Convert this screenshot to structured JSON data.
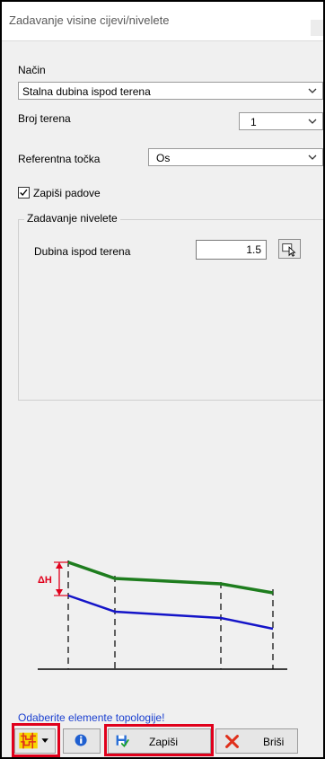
{
  "window": {
    "title": "Zadavanje visine cijevi/nivelete"
  },
  "mode": {
    "label": "Način",
    "value": "Stalna dubina ispod terena"
  },
  "terrain_count": {
    "label": "Broj terena",
    "value": "1"
  },
  "reference_point": {
    "label": "Referentna točka",
    "value": "Os"
  },
  "save_slopes": {
    "label": "Zapiši padove",
    "checked": true
  },
  "grade_group": {
    "title": "Zadavanje nivelete",
    "depth_label": "Dubina ispod terena",
    "depth_value": "1.5"
  },
  "diagram": {
    "delta_label": "ΔH",
    "upper_color": "#1e7d1e",
    "lower_color": "#1414c8"
  },
  "hint": "Odaberite elemente topologije!",
  "toolbar": {
    "save_label": "Zapiši",
    "delete_label": "Briši"
  },
  "colors": {
    "highlight": "#e0001b",
    "hint_text": "#1a3fd0"
  }
}
